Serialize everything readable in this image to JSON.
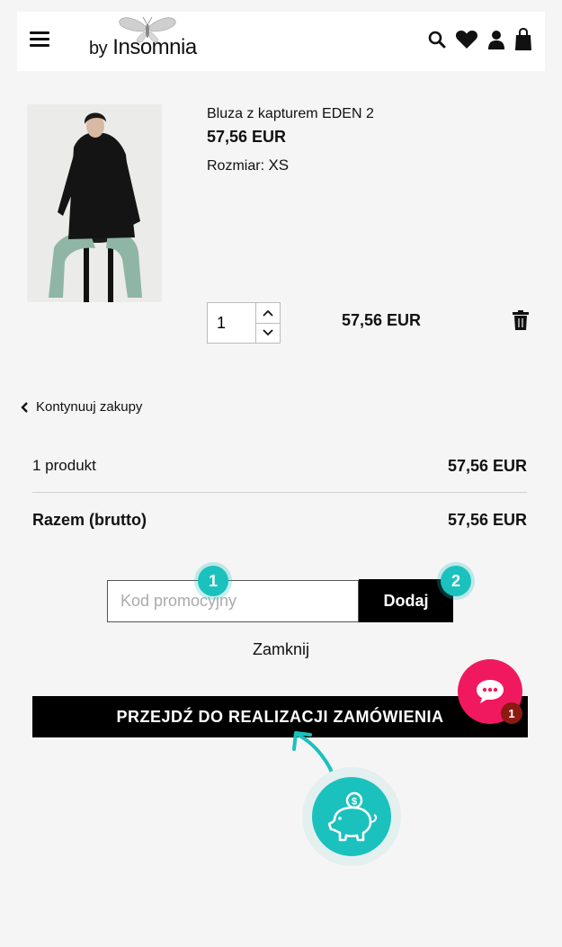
{
  "header": {
    "logo_prefix": "by",
    "logo_name": "Insomnia",
    "icons": [
      "menu-icon",
      "search-icon",
      "heart-icon",
      "user-icon",
      "bag-icon"
    ]
  },
  "product": {
    "name": "Bluza z kapturem EDEN 2",
    "price": "57,56 EUR",
    "size_label": "Rozmiar:",
    "size_value": "XS",
    "quantity": "1",
    "line_total": "57,56 EUR"
  },
  "nav": {
    "continue_label": "Kontynuuj zakupy"
  },
  "summary": {
    "items_label": "1 produkt",
    "items_value": "57,56 EUR",
    "total_label": "Razem (brutto)",
    "total_value": "57,56 EUR"
  },
  "promo": {
    "placeholder": "Kod promocyjny",
    "add_label": "Dodaj",
    "badge1": "1",
    "badge2": "2",
    "close_label": "Zamknij"
  },
  "checkout": {
    "label": "PRZEJDŹ DO REALIZACJI ZAMÓWIENIA"
  },
  "chat": {
    "count": "1"
  },
  "colors": {
    "accent": "#1bc1bd",
    "chat": "#f0195f",
    "chat_badge": "#8b1a12",
    "button": "#000000"
  }
}
